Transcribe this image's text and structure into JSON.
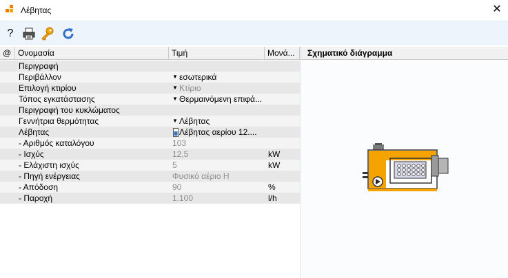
{
  "window": {
    "title": "Λέβητας",
    "close_glyph": "✕"
  },
  "toolbar": {
    "help": "?",
    "icons": [
      "print-icon",
      "key-icon",
      "refresh-icon"
    ]
  },
  "grid": {
    "headers": {
      "at": "@",
      "name": "Ονομασία",
      "value": "Τιμή",
      "unit": "Μονά..."
    },
    "rows": [
      {
        "name": "Περιγραφή",
        "value": "",
        "unit": "",
        "dropdown": false,
        "readonly": false
      },
      {
        "name": "Περιβάλλον",
        "value": "εσωτερικά",
        "unit": "",
        "dropdown": true,
        "readonly": false
      },
      {
        "name": "Επιλογή κτιρίου",
        "value": "Κτίριο",
        "unit": "",
        "dropdown": true,
        "readonly": true
      },
      {
        "name": "Τόπος εγκατάστασης",
        "value": "Θερμαινόμενη επιφά...",
        "unit": "",
        "dropdown": true,
        "readonly": false
      },
      {
        "name": "Περιγραφή του κυκλώματος",
        "value": "",
        "unit": "",
        "dropdown": false,
        "readonly": false
      },
      {
        "name": "Γεννήτρια θερμότητας",
        "value": "Λέβητας",
        "unit": "",
        "dropdown": true,
        "readonly": false
      },
      {
        "name": "Λέβητας",
        "value": "Λέβητας αερίου 12....",
        "unit": "",
        "dropdown": false,
        "readonly": false,
        "icon": "device-icon"
      },
      {
        "name": "- Αριθμός καταλόγου",
        "value": "103",
        "unit": "",
        "dropdown": false,
        "readonly": true
      },
      {
        "name": "- Ισχύς",
        "value": "12,5",
        "unit": "kW",
        "dropdown": false,
        "readonly": true
      },
      {
        "name": "- Ελάχιστη ισχύς",
        "value": "5",
        "unit": "kW",
        "dropdown": false,
        "readonly": true
      },
      {
        "name": "- Πηγή ενέργειας",
        "value": "Φυσικό αέριο Η",
        "unit": "",
        "dropdown": false,
        "readonly": true
      },
      {
        "name": "- Απόδοση",
        "value": "90",
        "unit": "%",
        "dropdown": false,
        "readonly": true
      },
      {
        "name": "- Παροχή",
        "value": "1.100",
        "unit": "l/h",
        "dropdown": false,
        "readonly": true
      }
    ]
  },
  "side": {
    "title": "Σχηματικό διάγραμμα"
  },
  "colors": {
    "accent_orange": "#f5a300",
    "toolbar_bg": "#eef4fb",
    "row_odd": "#e7e7e7",
    "row_even": "#f4f4f4",
    "readonly_text": "#8d8d8d"
  }
}
